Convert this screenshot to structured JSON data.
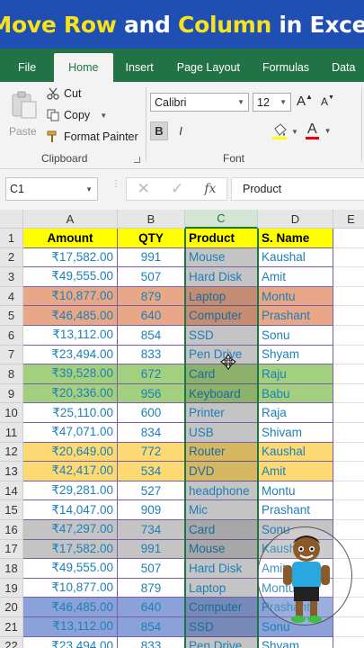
{
  "banner": {
    "part1": "Move Row",
    "part2": "and",
    "part3": "Column",
    "part4": "in Excel"
  },
  "tabs": [
    "File",
    "Home",
    "Insert",
    "Page Layout",
    "Formulas",
    "Data"
  ],
  "clipboard": {
    "paste": "Paste",
    "cut": "Cut",
    "copy": "Copy",
    "format_painter": "Format Painter",
    "label": "Clipboard"
  },
  "font": {
    "name": "Calibri",
    "size": "12",
    "grow": "A",
    "shrink": "A",
    "bold": "B",
    "italic": "I",
    "label": "Font",
    "fill_icon": "paint-bucket-icon",
    "font_color_letter": "A"
  },
  "formula": {
    "name_box": "C1",
    "fx": "fx",
    "value": "Product"
  },
  "columns": [
    "A",
    "B",
    "C",
    "D",
    "E"
  ],
  "headers": {
    "amount": "Amount",
    "qty": "QTY",
    "product": "Product",
    "name": "S. Name"
  },
  "colors": {
    "salmon": "#e8a787",
    "green": "#a3d07e",
    "gold": "#fcd973",
    "gray": "#c4c4c4",
    "blue": "#8aa2d8",
    "yellow": "#ffff00",
    "accent": "#217346",
    "title_bg": "#1f4fb3"
  },
  "rows": [
    {
      "n": "2",
      "amount": "₹17,582.00",
      "qty": "991",
      "product": "Mouse",
      "name": "Kaushal",
      "fill": ""
    },
    {
      "n": "3",
      "amount": "₹49,555.00",
      "qty": "507",
      "product": "Hard Disk",
      "name": "Amit",
      "fill": ""
    },
    {
      "n": "4",
      "amount": "₹10,877.00",
      "qty": "879",
      "product": "Laptop",
      "name": "Montu",
      "fill": "salmon"
    },
    {
      "n": "5",
      "amount": "₹46,485.00",
      "qty": "640",
      "product": "Computer",
      "name": "Prashant",
      "fill": "salmon"
    },
    {
      "n": "6",
      "amount": "₹13,112.00",
      "qty": "854",
      "product": "SSD",
      "name": "Sonu",
      "fill": ""
    },
    {
      "n": "7",
      "amount": "₹23,494.00",
      "qty": "833",
      "product": "Pen Drive",
      "name": "Shyam",
      "fill": ""
    },
    {
      "n": "8",
      "amount": "₹39,528.00",
      "qty": "672",
      "product": "Card",
      "name": "Raju",
      "fill": "green"
    },
    {
      "n": "9",
      "amount": "₹20,336.00",
      "qty": "956",
      "product": "Keyboard",
      "name": "Babu",
      "fill": "green"
    },
    {
      "n": "10",
      "amount": "₹25,110.00",
      "qty": "600",
      "product": "Printer",
      "name": "Raja",
      "fill": ""
    },
    {
      "n": "11",
      "amount": "₹47,071.00",
      "qty": "834",
      "product": "USB",
      "name": "Shivam",
      "fill": ""
    },
    {
      "n": "12",
      "amount": "₹20,649.00",
      "qty": "772",
      "product": "Router",
      "name": "Kaushal",
      "fill": "gold"
    },
    {
      "n": "13",
      "amount": "₹42,417.00",
      "qty": "534",
      "product": "DVD",
      "name": "Amit",
      "fill": "gold"
    },
    {
      "n": "14",
      "amount": "₹29,281.00",
      "qty": "527",
      "product": "headphone",
      "name": "Montu",
      "fill": ""
    },
    {
      "n": "15",
      "amount": "₹14,047.00",
      "qty": "909",
      "product": "Mic",
      "name": "Prashant",
      "fill": ""
    },
    {
      "n": "16",
      "amount": "₹47,297.00",
      "qty": "734",
      "product": "Card",
      "name": "Sonu",
      "fill": "gray"
    },
    {
      "n": "17",
      "amount": "₹17,582.00",
      "qty": "991",
      "product": "Mouse",
      "name": "Kaushal",
      "fill": "gray"
    },
    {
      "n": "18",
      "amount": "₹49,555.00",
      "qty": "507",
      "product": "Hard Disk",
      "name": "Amit",
      "fill": ""
    },
    {
      "n": "19",
      "amount": "₹10,877.00",
      "qty": "879",
      "product": "Laptop",
      "name": "Montu",
      "fill": ""
    },
    {
      "n": "20",
      "amount": "₹46,485.00",
      "qty": "640",
      "product": "Computer",
      "name": "Prashant",
      "fill": "blue"
    },
    {
      "n": "21",
      "amount": "₹13,112.00",
      "qty": "854",
      "product": "SSD",
      "name": "Sonu",
      "fill": "blue"
    },
    {
      "n": "22",
      "amount": "₹23,494.00",
      "qty": "833",
      "product": "Pen Drive",
      "name": "Shyam",
      "fill": ""
    }
  ]
}
